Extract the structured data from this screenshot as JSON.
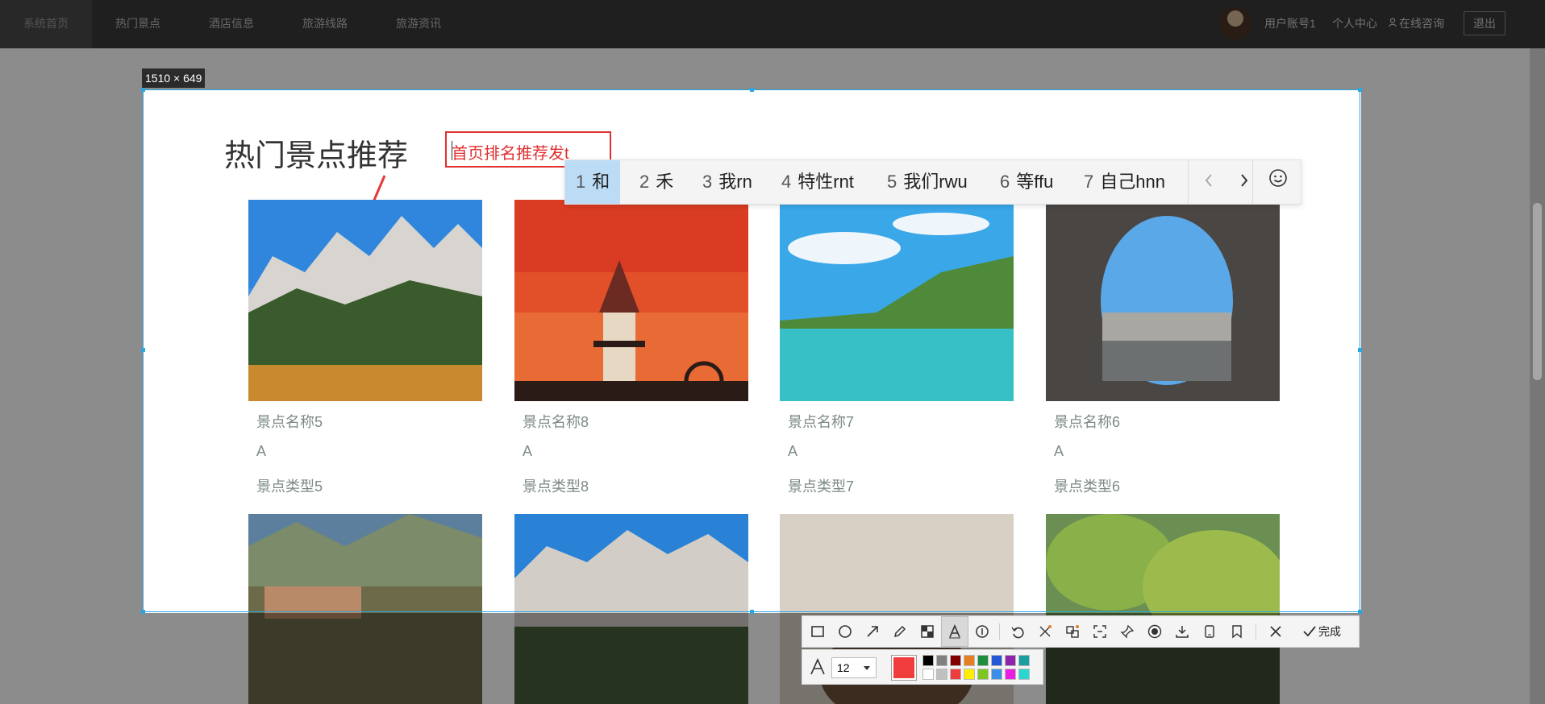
{
  "nav": {
    "items": [
      "系统首页",
      "热门景点",
      "酒店信息",
      "旅游线路",
      "旅游资讯"
    ],
    "account": "用户账号1",
    "personal_center": "个人中心",
    "online_consult": "在线咨询",
    "logout": "退出"
  },
  "section": {
    "title": "热门景点推荐"
  },
  "attractions": [
    {
      "name": "景点名称5",
      "level": "A",
      "type": "景点类型5"
    },
    {
      "name": "景点名称8",
      "level": "A",
      "type": "景点类型8"
    },
    {
      "name": "景点名称7",
      "level": "A",
      "type": "景点类型7"
    },
    {
      "name": "景点名称6",
      "level": "A",
      "type": "景点类型6"
    }
  ],
  "capture": {
    "size_label": "1510 × 649",
    "annotation_text": "首页排名推荐发t",
    "font_size": "12",
    "finish_label": "完成",
    "current_color": "#f03c3c",
    "palette": [
      "#000000",
      "#808080",
      "#800000",
      "#e67e22",
      "#1e8e3e",
      "#2456d6",
      "#8e24aa",
      "#1a9e9e",
      "#ffffff",
      "#c0c0c0",
      "#f03c3c",
      "#ffee00",
      "#7cc61f",
      "#3b8fe6",
      "#e91ee0",
      "#2ad6d0"
    ]
  },
  "ime": {
    "candidates": [
      {
        "num": "1",
        "text": "和"
      },
      {
        "num": "2",
        "text": "禾"
      },
      {
        "num": "3",
        "text": "我rn"
      },
      {
        "num": "4",
        "text": "特性rnt"
      },
      {
        "num": "5",
        "text": "我们rwu"
      },
      {
        "num": "6",
        "text": "等ffu"
      },
      {
        "num": "7",
        "text": "自己hnn"
      }
    ],
    "prev_icon": "chevron-left-icon",
    "next_icon": "chevron-right-icon",
    "emoji_icon": "smiley-icon"
  }
}
